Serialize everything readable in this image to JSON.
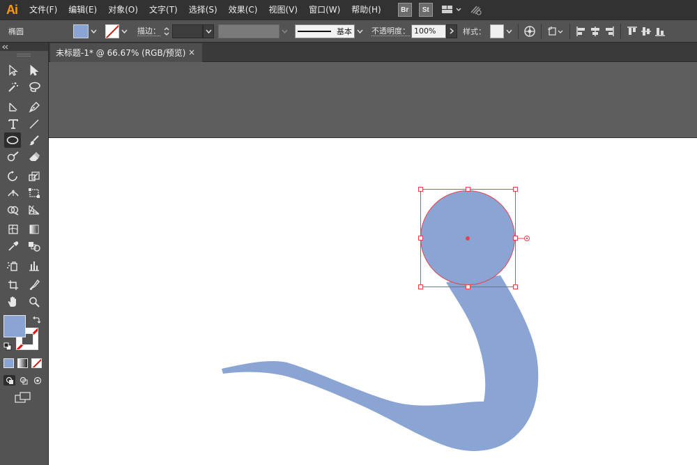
{
  "app": {
    "logo": "Ai"
  },
  "menu": {
    "items": [
      "文件(F)",
      "编辑(E)",
      "对象(O)",
      "文字(T)",
      "选择(S)",
      "效果(C)",
      "视图(V)",
      "窗口(W)",
      "帮助(H)"
    ],
    "bridge_label": "Br",
    "stock_label": "St"
  },
  "control_bar": {
    "object_type": "椭圆",
    "fill_color": "#8aa4d4",
    "stroke_label": "描边：",
    "brush_label": "基本",
    "opacity_label": "不透明度：",
    "opacity_value": "100%",
    "style_label": "样式："
  },
  "document": {
    "tab_title": "未标题-1* @ 66.67% (RGB/预览)",
    "close_symbol": "×"
  },
  "toolbox": {
    "fill_color": "#8aa4d4",
    "tools": [
      "selection-tool",
      "direct-selection-tool",
      "magic-wand-tool",
      "lasso-tool",
      "line-tool",
      "pen-tool",
      "type-tool",
      "line-segment-tool",
      "ellipse-tool",
      "paintbrush-tool",
      "blob-brush-tool",
      "eraser-tool",
      "rotate-tool",
      "scale-tool",
      "width-tool",
      "free-transform-tool",
      "shape-builder-tool",
      "perspective-grid-tool",
      "mesh-tool",
      "gradient-tool",
      "eyedropper-tool",
      "blend-tool",
      "symbol-sprayer-tool",
      "column-graph-tool",
      "artboard-tool",
      "slice-tool",
      "hand-tool",
      "zoom-tool"
    ]
  },
  "artwork": {
    "shape_color": "#8aa4d4",
    "selection_color": "#e8424b"
  }
}
